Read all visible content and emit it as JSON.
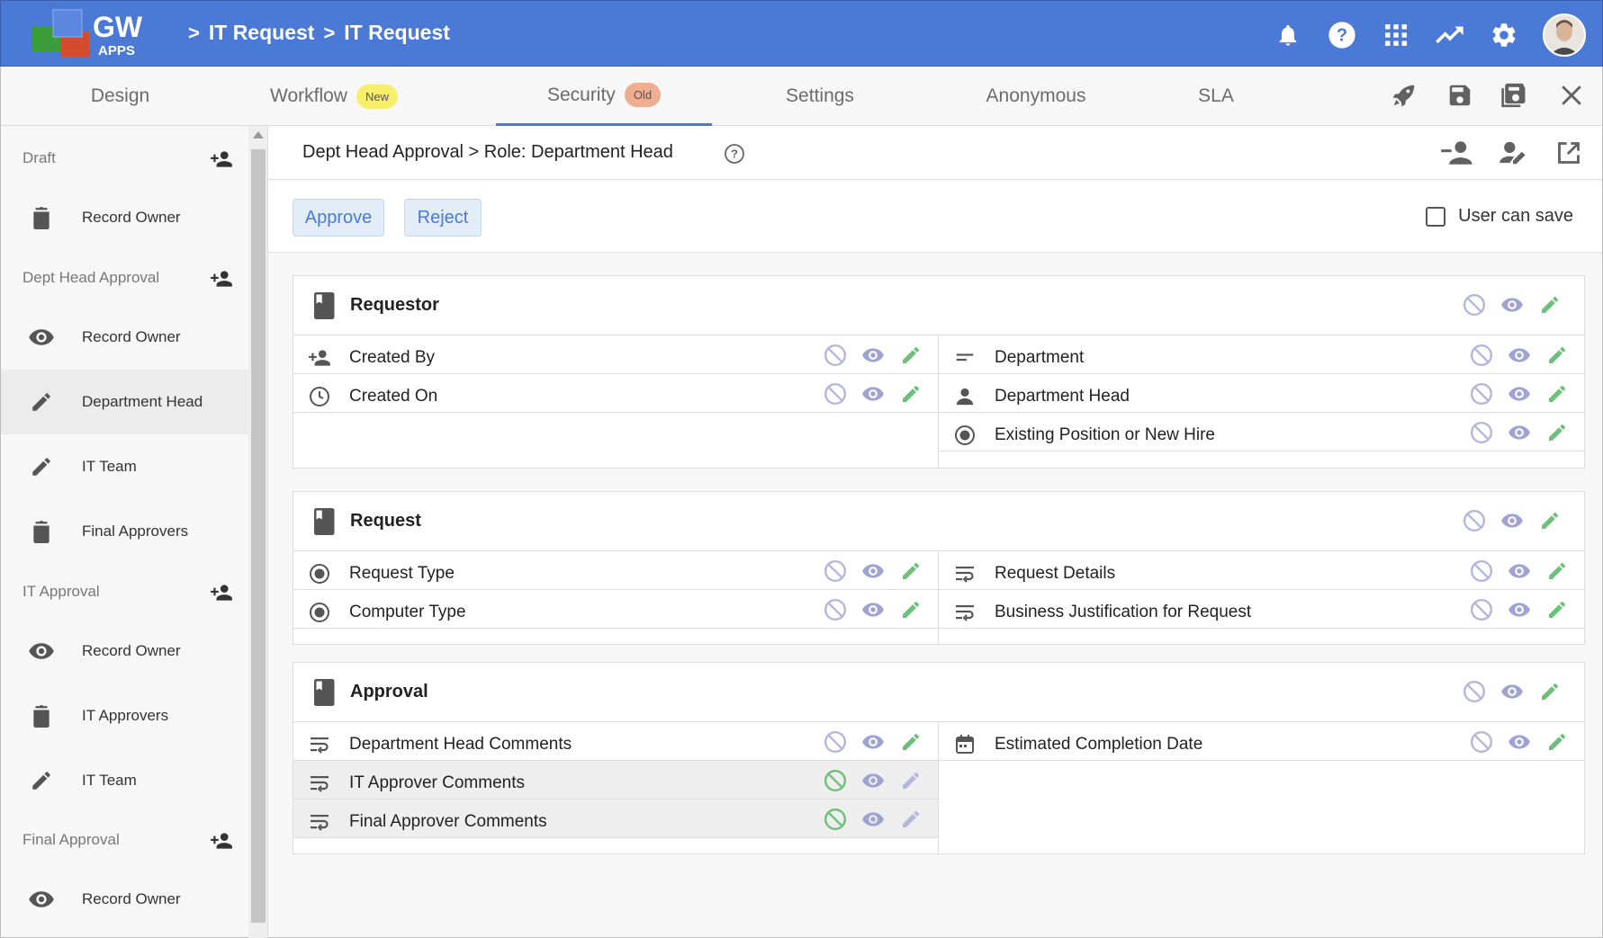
{
  "app": {
    "logo_text": "GW",
    "logo_sub": "APPS",
    "breadcrumbs": [
      "IT Request",
      "IT Request"
    ]
  },
  "tabs": [
    {
      "label": "Design",
      "badge": ""
    },
    {
      "label": "Workflow",
      "badge": "New"
    },
    {
      "label": "Security",
      "badge": "Old",
      "active": true
    },
    {
      "label": "Settings",
      "badge": ""
    },
    {
      "label": "Anonymous",
      "badge": ""
    },
    {
      "label": "SLA",
      "badge": ""
    }
  ],
  "sidebar": {
    "groups": [
      {
        "label": "Draft",
        "items": [
          {
            "icon": "trash-icon",
            "label": "Record Owner"
          }
        ]
      },
      {
        "label": "Dept Head Approval",
        "items": [
          {
            "icon": "eye-icon",
            "label": "Record Owner"
          },
          {
            "icon": "pencil-icon",
            "label": "Department Head",
            "active": true
          },
          {
            "icon": "pencil-icon",
            "label": "IT Team"
          },
          {
            "icon": "trash-icon",
            "label": "Final Approvers"
          }
        ]
      },
      {
        "label": "IT Approval",
        "items": [
          {
            "icon": "eye-icon",
            "label": "Record Owner"
          },
          {
            "icon": "trash-icon",
            "label": "IT Approvers"
          },
          {
            "icon": "pencil-icon",
            "label": "IT Team"
          }
        ]
      },
      {
        "label": "Final Approval",
        "items": [
          {
            "icon": "eye-icon",
            "label": "Record Owner"
          }
        ]
      }
    ]
  },
  "main": {
    "title": "Dept Head Approval > Role: Department Head",
    "approve_label": "Approve",
    "reject_label": "Reject",
    "user_can_save_label": "User can save"
  },
  "sections": [
    {
      "title": "Requestor",
      "left": [
        {
          "icon": "add-person-icon",
          "label": "Created By",
          "state": "edit"
        },
        {
          "icon": "clock-icon",
          "label": "Created On",
          "state": "edit"
        }
      ],
      "right": [
        {
          "icon": "short-text-icon",
          "label": "Department",
          "state": "edit"
        },
        {
          "icon": "person-icon",
          "label": "Department Head",
          "state": "edit"
        },
        {
          "icon": "radio-icon",
          "label": "Existing Position or New Hire",
          "state": "edit"
        }
      ]
    },
    {
      "title": "Request",
      "left": [
        {
          "icon": "radio-icon",
          "label": "Request Type",
          "state": "edit"
        },
        {
          "icon": "radio-icon",
          "label": "Computer Type",
          "state": "edit"
        }
      ],
      "right": [
        {
          "icon": "wrap-text-icon",
          "label": "Request Details",
          "state": "edit"
        },
        {
          "icon": "wrap-text-icon",
          "label": "Business Justification for Request",
          "state": "edit"
        }
      ]
    },
    {
      "title": "Approval",
      "left": [
        {
          "icon": "wrap-text-icon",
          "label": "Department Head Comments",
          "state": "edit"
        },
        {
          "icon": "wrap-text-icon",
          "label": "IT Approver Comments",
          "state": "hidden"
        },
        {
          "icon": "wrap-text-icon",
          "label": "Final Approver Comments",
          "state": "hidden"
        }
      ],
      "right": [
        {
          "icon": "calendar-icon",
          "label": "Estimated Completion Date",
          "state": "edit"
        }
      ]
    }
  ],
  "colors": {
    "brand_blue": "#4b79d6",
    "active_green": "#6cc07a",
    "inactive_purple": "#b4b6dc",
    "eye_purple": "#a0a3d2"
  }
}
